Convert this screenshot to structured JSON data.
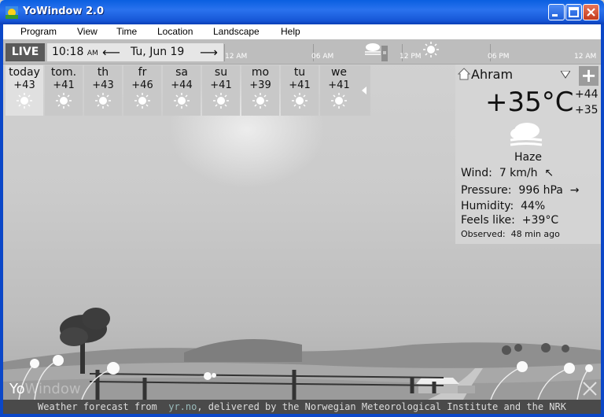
{
  "window": {
    "title": "YoWindow 2.0"
  },
  "menu": [
    "Program",
    "View",
    "Time",
    "Location",
    "Landscape",
    "Help"
  ],
  "timebar": {
    "live": "LIVE",
    "time": "10:18",
    "ampm": "AM",
    "date": "Tu, Jun 19",
    "ticks": [
      "12 AM",
      "06 AM",
      "12 PM",
      "06 PM",
      "12 AM"
    ]
  },
  "forecast": [
    {
      "day": "today",
      "temp": "+43"
    },
    {
      "day": "tom.",
      "temp": "+41"
    },
    {
      "day": "th",
      "temp": "+43"
    },
    {
      "day": "fr",
      "temp": "+46"
    },
    {
      "day": "sa",
      "temp": "+44"
    },
    {
      "day": "su",
      "temp": "+41"
    },
    {
      "day": "mo",
      "temp": "+39"
    },
    {
      "day": "tu",
      "temp": "+41"
    },
    {
      "day": "we",
      "temp": "+41"
    }
  ],
  "current": {
    "location": "Ahram",
    "temp": "+35°C",
    "high": "+44",
    "low": "+35",
    "condition": "Haze",
    "wind_label": "Wind:",
    "wind_value": "7 km/h",
    "pressure_label": "Pressure:",
    "pressure_value": "996 hPa",
    "humidity_label": "Humidity:",
    "humidity_value": "44%",
    "feels_label": "Feels like:",
    "feels_value": "+39°C",
    "observed_label": "Observed:",
    "observed_value": "48 min ago"
  },
  "branding": {
    "logo_a": "Yo",
    "logo_b": "Window"
  },
  "credit": {
    "prefix": "Weather forecast from",
    "link": "yr.no",
    "suffix": ", delivered by the Norwegian Meteorological Institute and the NRK"
  },
  "icons": {
    "sun": "sun-icon",
    "haze": "haze-icon",
    "home": "home-icon",
    "prev": "arrow-left-icon",
    "next": "arrow-right-icon",
    "dropdown": "chevron-down-icon"
  }
}
